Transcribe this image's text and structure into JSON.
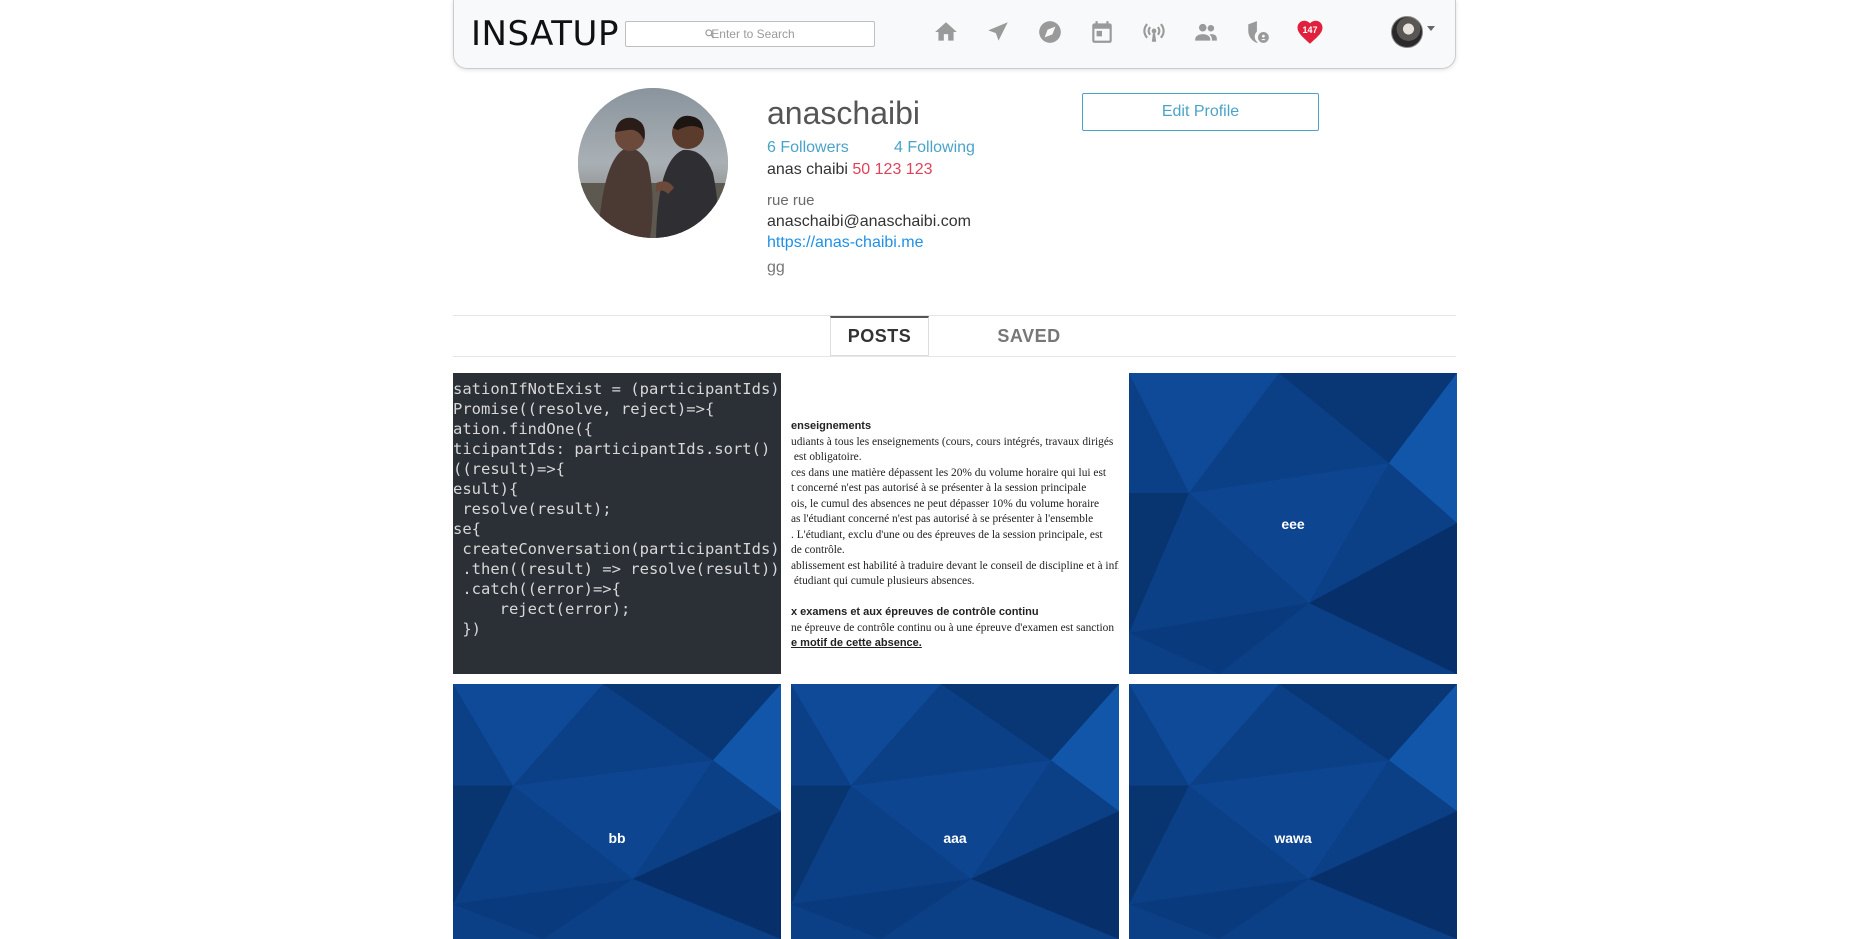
{
  "navbar": {
    "brand": "INSATUP",
    "search_placeholder": "Enter to Search",
    "icons": [
      "home-icon",
      "send-icon",
      "explore-icon",
      "calendar-icon",
      "broadcast-icon",
      "people-icon",
      "security-icon",
      "heart-icon",
      "avatar"
    ],
    "notification_count": "147"
  },
  "profile": {
    "username": "anaschaibi",
    "followers": "6 Followers",
    "following": "4 Following",
    "full_name": "anas chaibi",
    "phone": "50 123 123",
    "address": "rue rue",
    "email": "anaschaibi@anaschaibi.com",
    "website": "https://anas-chaibi.me",
    "bio": "gg",
    "edit_button": "Edit Profile"
  },
  "tabs": [
    {
      "label": "POSTS",
      "active": true
    },
    {
      "label": "SAVED",
      "active": false
    }
  ],
  "posts": [
    {
      "type": "code-image"
    },
    {
      "type": "document-image"
    },
    {
      "type": "text",
      "title": "eee"
    },
    {
      "type": "text",
      "title": "bb"
    },
    {
      "type": "text",
      "title": "aaa"
    },
    {
      "type": "text",
      "title": "wawa"
    }
  ],
  "code_snippet": [
    "sationIfNotExist = (participantIds)",
    "Promise((resolve, reject)=>{",
    "ation.findOne({",
    "ticipantIds: participantIds.sort()",
    "((result)=>{",
    "esult){",
    " resolve(result);",
    "se{",
    " createConversation(participantIds)",
    " .then((result) => resolve(result))",
    " .catch((error)=>{",
    "     reject(error);",
    " })"
  ],
  "document_snippet": {
    "heading1": "enseignements",
    "lines1": [
      "udiants à tous les enseignements (cours, cours intégrés, travaux dirigés",
      " est obligatoire.",
      "ces dans une matière dépassent les 20% du volume horaire qui lui est",
      "t concerné n'est pas autorisé à se présenter à la session principale",
      "ois, le cumul des absences ne peut dépasser 10% du volume horaire",
      "as l'étudiant concerné n'est pas autorisé à se présenter à l'ensemble",
      ". L'étudiant, exclu d'une ou des épreuves de la session principale, est",
      "de contrôle.",
      "ablissement est habilité à traduire devant le conseil de discipline et à infliger",
      " étudiant qui cumule plusieurs absences."
    ],
    "heading2": "x examens et aux épreuves de contrôle continu",
    "lines2": [
      "ne épreuve de contrôle continu ou à une épreuve d'examen est sanction",
      "e motif de cette absence."
    ]
  },
  "colors": {
    "accent": "#4aa3c9",
    "phone": "#e0425a",
    "link": "#1e90e8",
    "tile_blue": "#0b3f86",
    "heart": "#e0203c"
  }
}
